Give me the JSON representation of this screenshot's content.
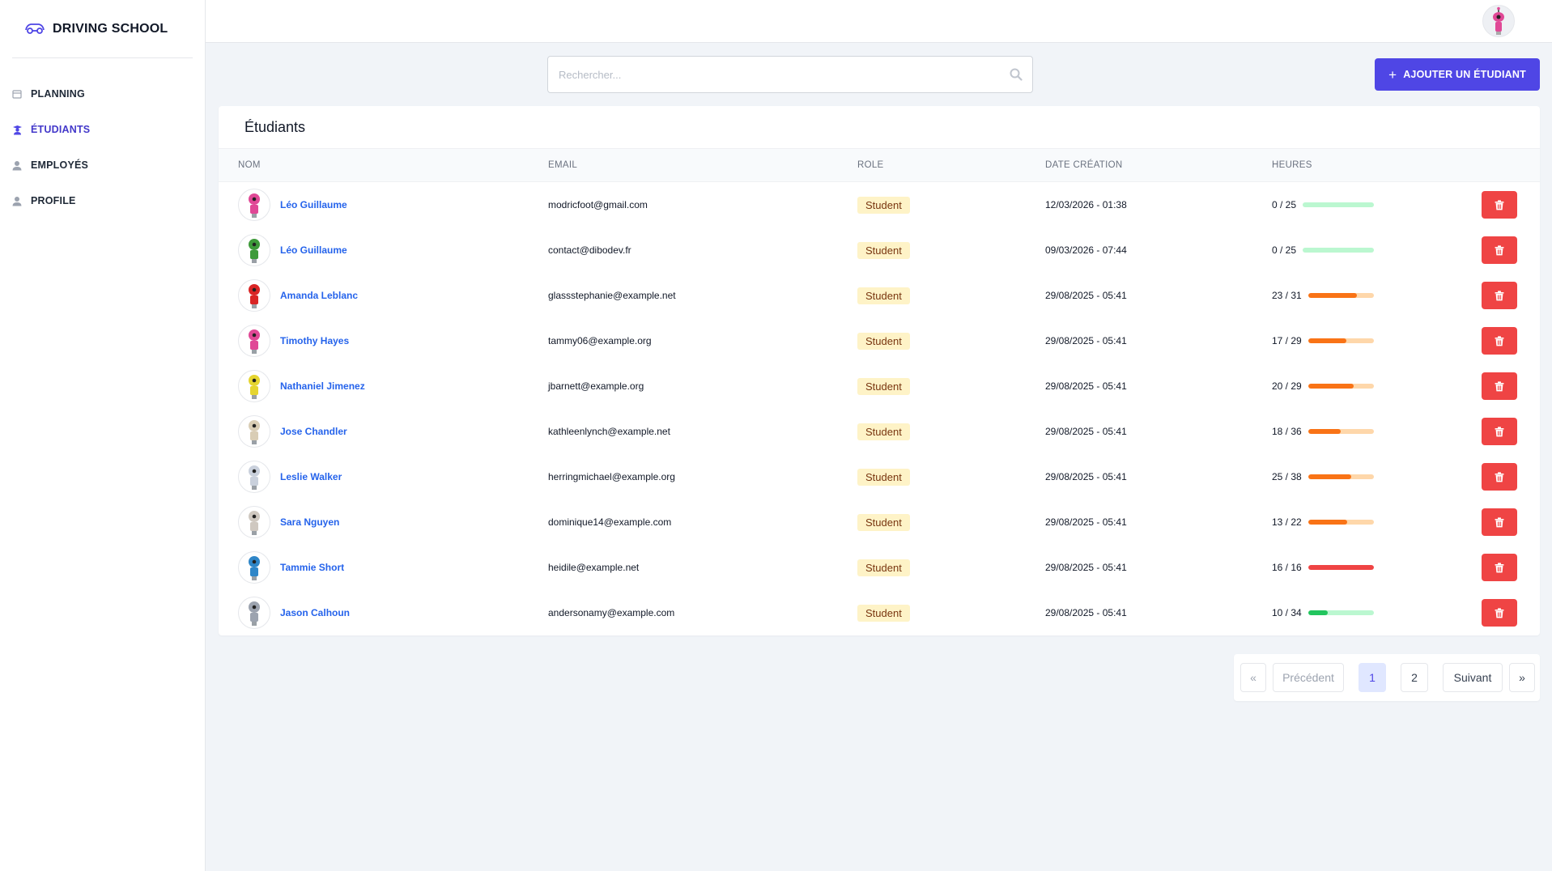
{
  "app": {
    "brand": "DRIVING SCHOOL"
  },
  "sidebar": {
    "items": [
      {
        "label": "PLANNING",
        "icon": "calendar-icon",
        "active": false
      },
      {
        "label": "ÉTUDIANTS",
        "icon": "student-icon",
        "active": true
      },
      {
        "label": "EMPLOYÉS",
        "icon": "user-icon",
        "active": false
      },
      {
        "label": "PROFILE",
        "icon": "user-icon",
        "active": false
      }
    ]
  },
  "search": {
    "placeholder": "Rechercher...",
    "value": ""
  },
  "add_button": {
    "label": "AJOUTER UN ÉTUDIANT"
  },
  "table": {
    "title": "Étudiants",
    "columns": [
      "NOM",
      "EMAIL",
      "ROLE",
      "DATE CRÉATION",
      "HEURES"
    ],
    "rows": [
      {
        "name": "Léo Guillaume",
        "email": "modricfoot@gmail.com",
        "role": "Student",
        "date": "12/03/2026 - 01:38",
        "hours": "0 / 25",
        "done": 0,
        "total": 25,
        "avatar_color": "#e04896"
      },
      {
        "name": "Léo Guillaume",
        "email": "contact@dibodev.fr",
        "role": "Student",
        "date": "09/03/2026 - 07:44",
        "hours": "0 / 25",
        "done": 0,
        "total": 25,
        "avatar_color": "#3e9a3a"
      },
      {
        "name": "Amanda Leblanc",
        "email": "glassstephanie@example.net",
        "role": "Student",
        "date": "29/08/2025 - 05:41",
        "hours": "23 / 31",
        "done": 23,
        "total": 31,
        "avatar_color": "#d92525"
      },
      {
        "name": "Timothy Hayes",
        "email": "tammy06@example.org",
        "role": "Student",
        "date": "29/08/2025 - 05:41",
        "hours": "17 / 29",
        "done": 17,
        "total": 29,
        "avatar_color": "#e04896"
      },
      {
        "name": "Nathaniel Jimenez",
        "email": "jbarnett@example.org",
        "role": "Student",
        "date": "29/08/2025 - 05:41",
        "hours": "20 / 29",
        "done": 20,
        "total": 29,
        "avatar_color": "#e5d530"
      },
      {
        "name": "Jose Chandler",
        "email": "kathleenlynch@example.net",
        "role": "Student",
        "date": "29/08/2025 - 05:41",
        "hours": "18 / 36",
        "done": 18,
        "total": 36,
        "avatar_color": "#d9cdb5"
      },
      {
        "name": "Leslie Walker",
        "email": "herringmichael@example.org",
        "role": "Student",
        "date": "29/08/2025 - 05:41",
        "hours": "25 / 38",
        "done": 25,
        "total": 38,
        "avatar_color": "#c9d0dc"
      },
      {
        "name": "Sara Nguyen",
        "email": "dominique14@example.com",
        "role": "Student",
        "date": "29/08/2025 - 05:41",
        "hours": "13 / 22",
        "done": 13,
        "total": 22,
        "avatar_color": "#cfc8c0"
      },
      {
        "name": "Tammie Short",
        "email": "heidile@example.net",
        "role": "Student",
        "date": "29/08/2025 - 05:41",
        "hours": "16 / 16",
        "done": 16,
        "total": 16,
        "avatar_color": "#2f86c8"
      },
      {
        "name": "Jason Calhoun",
        "email": "andersonamy@example.com",
        "role": "Student",
        "date": "29/08/2025 - 05:41",
        "hours": "10 / 34",
        "done": 10,
        "total": 34,
        "avatar_color": "#9ca3af"
      }
    ]
  },
  "pagination": {
    "first": "«",
    "prev": "Précédent",
    "pages": [
      "1",
      "2"
    ],
    "current": "1",
    "next": "Suivant",
    "last": "»"
  },
  "colors": {
    "accent": "#4f46e5",
    "danger": "#ef4444",
    "progress_low": "#22c55e",
    "progress_mid": "#f97316",
    "progress_full": "#ef4444"
  }
}
